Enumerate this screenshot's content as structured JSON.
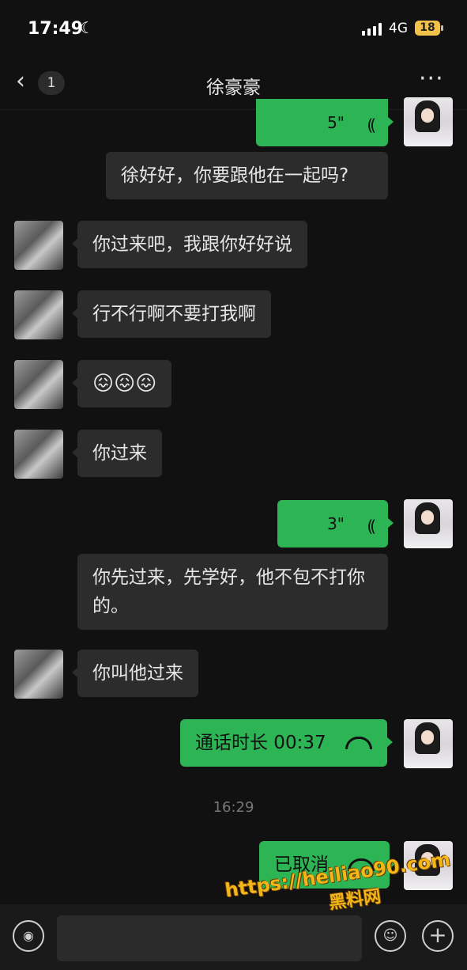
{
  "status_bar": {
    "time": "17:49",
    "network": "4G",
    "battery": "18"
  },
  "nav": {
    "back_icon": "chevron-left-icon",
    "unread_count": "1",
    "title": "徐豪豪",
    "more_label": "···"
  },
  "messages": {
    "voice1": {
      "duration": "5\""
    },
    "m1": "徐好好，你要跟他在一起吗?",
    "m2": "你过来吧，我跟你好好说",
    "m3": "行不行啊不要打我啊",
    "m4": "😖😖😖",
    "m5": "你过来",
    "voice2": {
      "duration": "3\""
    },
    "m6": "你先过来，先学好，他不包不打你的。",
    "m7": "你叫他过来",
    "call1": "通话时长 00:37",
    "call2": "已取消"
  },
  "timestamp": "16:29",
  "input_bar": {
    "text_value": ""
  },
  "watermark": {
    "url": "https://heiliao90.com",
    "site": "黑料网"
  },
  "colors": {
    "background": "#111111",
    "bubble_in": "#2c2c2c",
    "bubble_out": "#2db455",
    "watermark": "#f2b61b"
  }
}
